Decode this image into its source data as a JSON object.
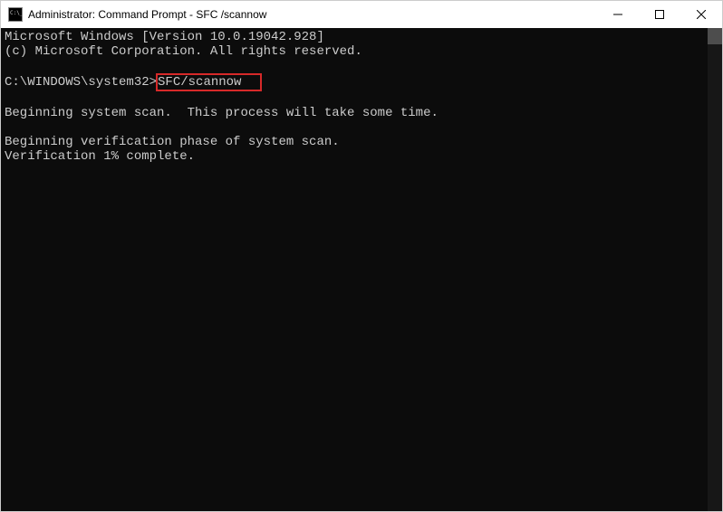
{
  "window": {
    "title": "Administrator: Command Prompt - SFC /scannow"
  },
  "console": {
    "line1": "Microsoft Windows [Version 10.0.19042.928]",
    "line2": "(c) Microsoft Corporation. All rights reserved.",
    "prompt": "C:\\WINDOWS\\system32>",
    "command": "SFC/scannow",
    "line3": "Beginning system scan.  This process will take some time.",
    "line4": "Beginning verification phase of system scan.",
    "line5": "Verification 1% complete."
  }
}
